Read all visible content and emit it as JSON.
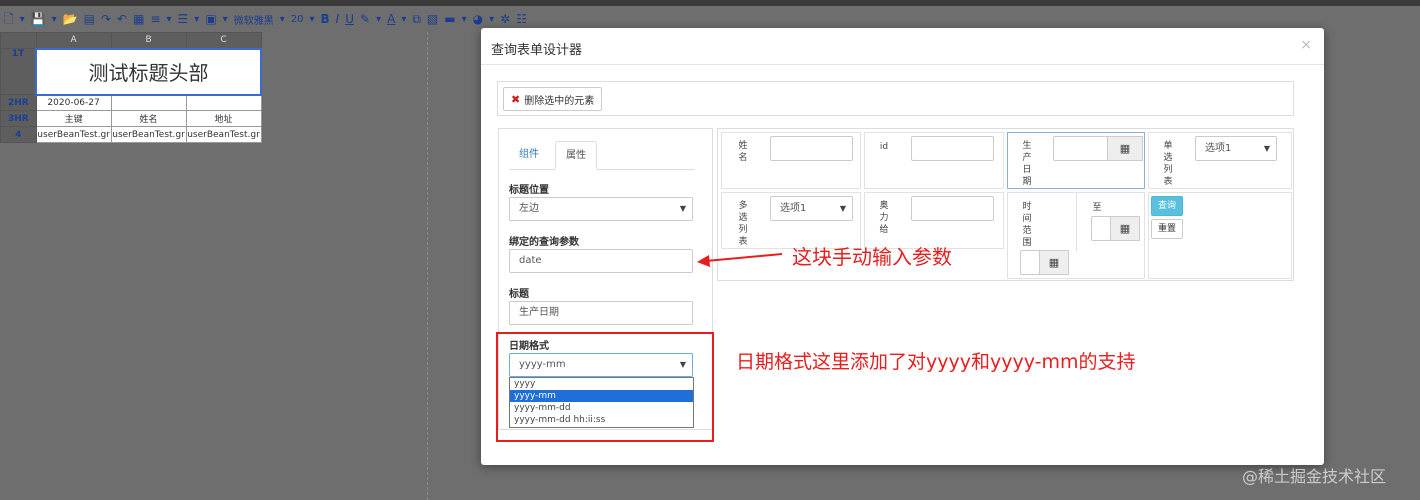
{
  "toolbar": {
    "font_name": "微软雅黑",
    "font_size": "20",
    "bold": "B",
    "italic": "I",
    "underline": "U",
    "font_color": "A"
  },
  "sheet": {
    "columns": [
      "A",
      "B",
      "C"
    ],
    "rows": [
      {
        "header": "1T",
        "cells": [
          "测试标题头部"
        ]
      },
      {
        "header": "2HR",
        "cells": [
          "2020-06-27",
          "",
          ""
        ]
      },
      {
        "header": "3HR",
        "cells": [
          "主键",
          "姓名",
          "地址"
        ]
      },
      {
        "header": "4",
        "cells": [
          "userBeanTest.gr",
          "userBeanTest.gr",
          "userBeanTest.gr"
        ]
      }
    ]
  },
  "dialog": {
    "title": "查询表单设计器",
    "close": "×",
    "delete_button": "删除选中的元素",
    "tabs": [
      "组件",
      "属性"
    ],
    "fields": {
      "label_pos_label": "标题位置",
      "label_pos_value": "左边",
      "bind_param_label": "绑定的查询参数",
      "bind_param_value": "date",
      "title_label": "标题",
      "title_value": "生产日期",
      "date_format_label": "日期格式",
      "date_format_value": "yyyy-mm",
      "date_format_options": [
        "yyyy",
        "yyyy-mm",
        "yyyy-mm-dd",
        "yyyy-mm-dd hh:ii:ss"
      ]
    },
    "form": {
      "name_label": [
        "姓",
        "名"
      ],
      "id_label": "id",
      "prod_date_label": [
        "生",
        "产",
        "日",
        "期"
      ],
      "radio_label": [
        "单",
        "选",
        "列",
        "表"
      ],
      "radio_value": "选项1",
      "multi_label": [
        "多",
        "选",
        "列",
        "表"
      ],
      "multi_value": "选项1",
      "award_label": [
        "奥",
        "力",
        "给"
      ],
      "time_range_label": [
        "时",
        "间",
        "范",
        "围"
      ],
      "to_label": "至",
      "query_button": "查询",
      "reset_button": "重置"
    }
  },
  "annotations": {
    "note_param": "这块手动输入参数",
    "note_date_format": "日期格式这里添加了对yyyy和yyyy-mm的支持"
  },
  "watermark": "@稀土掘金技术社区",
  "colors": {
    "annotation": "#e81e1e",
    "selected_option": "#1e6fd9",
    "query_button": "#5bc0de"
  }
}
